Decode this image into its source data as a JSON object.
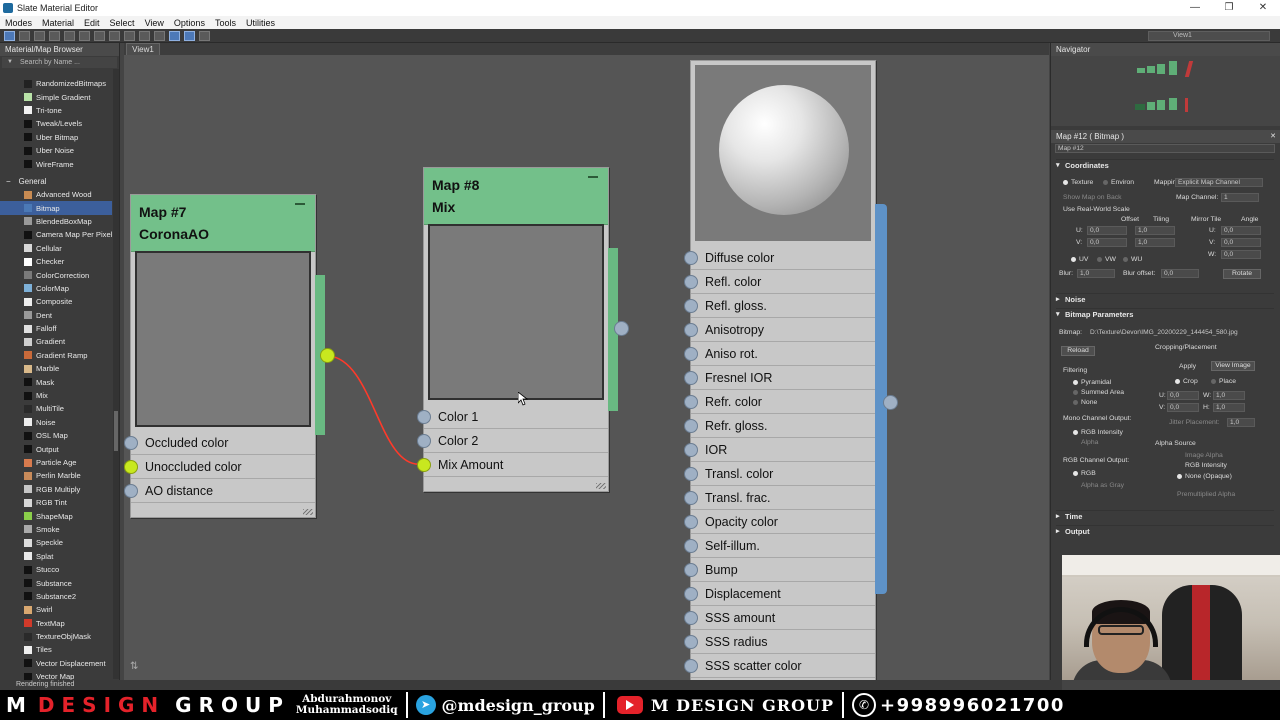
{
  "window": {
    "title": "Slate Material Editor",
    "minimize": "—",
    "restore": "❐",
    "close": "✕"
  },
  "menu": [
    "Modes",
    "Material",
    "Edit",
    "Select",
    "View",
    "Options",
    "Tools",
    "Utilities"
  ],
  "toolbar": {
    "view_dropdown": "View1"
  },
  "browser": {
    "title": "Material/Map Browser",
    "search_placeholder": "Search by Name ...",
    "top_items": [
      {
        "label": "RandomizedBitmaps",
        "color": "#222222"
      },
      {
        "label": "Simple Gradient",
        "color": "#b9e3a8"
      },
      {
        "label": "Tri-tone",
        "color": "#f2f2f2"
      },
      {
        "label": "Tweak/Levels",
        "color": "#111111"
      },
      {
        "label": "Uber Bitmap",
        "color": "#111111"
      },
      {
        "label": "Uber Noise",
        "color": "#111111"
      },
      {
        "label": "WireFrame",
        "color": "#111111"
      }
    ],
    "category": "General",
    "items": [
      {
        "label": "Advanced Wood",
        "color": "#c88b52"
      },
      {
        "label": "Bitmap",
        "color": "#4b79b6",
        "selected": true
      },
      {
        "label": "BlendedBoxMap",
        "color": "#9a9a9a"
      },
      {
        "label": "Camera Map Per Pixel",
        "color": "#111111"
      },
      {
        "label": "Cellular",
        "color": "#d8d8d8"
      },
      {
        "label": "Checker",
        "color": "#ffffff"
      },
      {
        "label": "ColorCorrection",
        "color": "#7a7a7a"
      },
      {
        "label": "ColorMap",
        "color": "#7db0d8"
      },
      {
        "label": "Composite",
        "color": "#eeeeee"
      },
      {
        "label": "Dent",
        "color": "#9a9a9a"
      },
      {
        "label": "Falloff",
        "color": "#e0e0e0"
      },
      {
        "label": "Gradient",
        "color": "#cfcfcf"
      },
      {
        "label": "Gradient Ramp",
        "color": "#c96a3a"
      },
      {
        "label": "Marble",
        "color": "#d9b98a"
      },
      {
        "label": "Mask",
        "color": "#111111"
      },
      {
        "label": "Mix",
        "color": "#111111"
      },
      {
        "label": "MultiTile",
        "color": "#2a2a2a"
      },
      {
        "label": "Noise",
        "color": "#eeeeee"
      },
      {
        "label": "OSL Map",
        "color": "#111111"
      },
      {
        "label": "Output",
        "color": "#111111"
      },
      {
        "label": "Particle Age",
        "color": "#d87b4e"
      },
      {
        "label": "Perlin Marble",
        "color": "#c98b5a"
      },
      {
        "label": "RGB Multiply",
        "color": "#c6c6c6"
      },
      {
        "label": "RGB Tint",
        "color": "#d8d8d8"
      },
      {
        "label": "ShapeMap",
        "color": "#8bcf4a"
      },
      {
        "label": "Smoke",
        "color": "#aaaaaa"
      },
      {
        "label": "Speckle",
        "color": "#dddddd"
      },
      {
        "label": "Splat",
        "color": "#e9e9e9"
      },
      {
        "label": "Stucco",
        "color": "#111111"
      },
      {
        "label": "Substance",
        "color": "#111111"
      },
      {
        "label": "Substance2",
        "color": "#111111"
      },
      {
        "label": "Swirl",
        "color": "#d9a870"
      },
      {
        "label": "TextMap",
        "color": "#d13a2a"
      },
      {
        "label": "TextureObjMask",
        "color": "#2a2a2a"
      },
      {
        "label": "Tiles",
        "color": "#eeeeee"
      },
      {
        "label": "Vector Displacement",
        "color": "#111111"
      },
      {
        "label": "Vector Map",
        "color": "#111111"
      }
    ]
  },
  "view": {
    "tab": "View1"
  },
  "nodes": {
    "map7": {
      "title_line1": "Map #7",
      "title_line2": "CoronaAO",
      "ports": [
        "Occluded color",
        "Unoccluded color",
        "AO distance"
      ]
    },
    "map8": {
      "title_line1": "Map #8",
      "title_line2": "Mix",
      "ports": [
        "Color 1",
        "Color 2",
        "Mix Amount"
      ]
    },
    "material": {
      "ports": [
        "Diffuse color",
        "Refl. color",
        "Refl. gloss.",
        "Anisotropy",
        "Aniso rot.",
        "Fresnel IOR",
        "Refr. color",
        "Refr. gloss.",
        "IOR",
        "Transl. color",
        "Transl. frac.",
        "Opacity color",
        "Self-illum.",
        "Bump",
        "Displacement",
        "SSS amount",
        "SSS radius",
        "SSS scatter color"
      ]
    }
  },
  "navigator": {
    "title": "Navigator"
  },
  "params": {
    "title": "Map #12  ( Bitmap )",
    "map_name": "Map #12",
    "coordinates": "Coordinates",
    "texture": "Texture",
    "environ": "Environ",
    "mapping_label": "Mapping:",
    "mapping_value": "Explicit Map Channel",
    "show_map_on_back": "Show Map on Back",
    "map_channel_label": "Map Channel:",
    "map_channel_value": "1",
    "real_world": "Use Real-World Scale",
    "offset": "Offset",
    "tiling": "Tiling",
    "mirror_tile": "Mirror Tile",
    "angle": "Angle",
    "u_label": "U:",
    "v_label": "V:",
    "w_label": "W:",
    "zero": "0,0",
    "one": "1,0",
    "uv": "UV",
    "vw": "VW",
    "wu": "WU",
    "blur_label": "Blur:",
    "blur_value": "1,0",
    "blur_offset_label": "Blur offset:",
    "blur_offset_value": "0,0",
    "rotate": "Rotate",
    "noise": "Noise",
    "bitmap_params": "Bitmap Parameters",
    "bitmap_label": "Bitmap:",
    "bitmap_path": "D:\\Texture\\Devor\\IMG_20200229_144454_580.jpg",
    "reload": "Reload",
    "cropping": "Cropping/Placement",
    "apply": "Apply",
    "view_image": "View Image",
    "crop": "Crop",
    "place": "Place",
    "filtering": "Filtering",
    "pyramidal": "Pyramidal",
    "summed_area": "Summed Area",
    "none": "None",
    "w_field": "W:",
    "h_field": "H:",
    "jitter": "Jitter Placement:",
    "jitter_value": "1,0",
    "mono_output": "Mono Channel Output:",
    "rgb_intensity": "RGB Intensity",
    "alpha": "Alpha",
    "rgb_output": "RGB Channel Output:",
    "rgb": "RGB",
    "alpha_as_gray": "Alpha as Gray",
    "alpha_source": "Alpha Source",
    "image_alpha": "Image Alpha",
    "none_opaque": "None (Opaque)",
    "premult": "Premultiplied Alpha",
    "time": "Time",
    "output": "Output"
  },
  "status": {
    "text": "Rendering finished"
  },
  "brand": {
    "m": "M",
    "design": "DESIGN",
    "group": "GROUP",
    "name1": "Abdurahmonov",
    "name2": "Muhammadsodiq",
    "telegram_icon": "➤",
    "telegram": "@mdesign_group",
    "youtube": "M DESIGN GROUP",
    "phone_icon": "✆",
    "phone": "+998996021700"
  }
}
